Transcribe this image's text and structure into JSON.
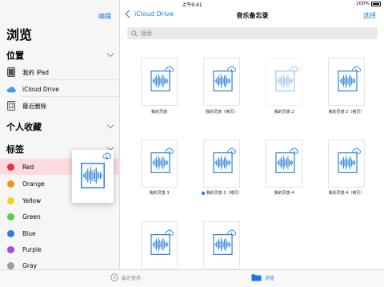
{
  "status_bar": {
    "device": "iPad",
    "time": "上午9:41",
    "battery": "100%"
  },
  "sidebar": {
    "edit_label": "编辑",
    "title": "浏览",
    "sections": {
      "locations": "位置",
      "favorites": "个人收藏",
      "tags": "标签"
    },
    "locations": [
      {
        "label": "我的 iPad",
        "icon": "ipad-icon"
      },
      {
        "label": "iCloud Drive",
        "icon": "icloud-icon"
      },
      {
        "label": "最近删除",
        "icon": "trash-icon"
      }
    ],
    "tags": [
      {
        "label": "Red",
        "color": "#e5333f",
        "selected": true
      },
      {
        "label": "Orange",
        "color": "#f39a15"
      },
      {
        "label": "Yellow",
        "color": "#f5d31b"
      },
      {
        "label": "Green",
        "color": "#4bd34a"
      },
      {
        "label": "Blue",
        "color": "#2f7be0"
      },
      {
        "label": "Purple",
        "color": "#a64ad6"
      },
      {
        "label": "Gray",
        "color": "#9b9ba0"
      }
    ]
  },
  "navbar": {
    "back_label": "iCloud Drive",
    "title": "音乐备忘录",
    "select_label": "选择"
  },
  "search": {
    "placeholder": "搜索"
  },
  "files": [
    {
      "name": "我的灵感",
      "dim": false,
      "dot": false
    },
    {
      "name": "我的灵感（拷贝）",
      "dim": false,
      "dot": false
    },
    {
      "name": "我的灵感 2",
      "dim": true,
      "dot": false
    },
    {
      "name": "我的灵感 2（拷贝）",
      "dim": false,
      "dot": false
    },
    {
      "name": "我的灵感 3",
      "dim": false,
      "dot": false
    },
    {
      "name": "我的灵感 3（拷贝）",
      "dim": false,
      "dot": true
    },
    {
      "name": "我的灵感 4",
      "dim": false,
      "dot": false
    },
    {
      "name": "我的灵感 4（拷贝）",
      "dim": false,
      "dot": false
    },
    {
      "name": "",
      "dim": false,
      "dot": false
    },
    {
      "name": "",
      "dim": false,
      "dot": false
    }
  ],
  "tabbar": {
    "recent_label": "最近使用",
    "browse_label": "浏览"
  },
  "colors": {
    "accent": "#1878e6",
    "waveform": "#2f86d6",
    "selected_row": "#fcdadd"
  }
}
